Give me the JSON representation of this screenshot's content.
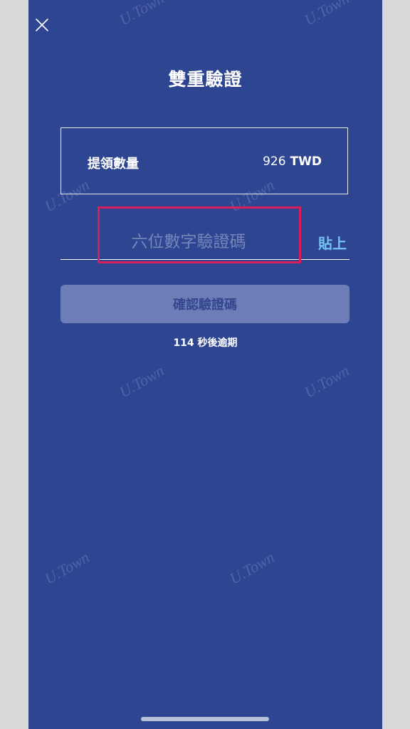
{
  "header": {
    "title": "雙重驗證",
    "close_icon": "close-icon"
  },
  "withdrawal": {
    "label": "提領數量",
    "amount": "926",
    "currency": "TWD"
  },
  "verification": {
    "placeholder": "六位數字驗證碼",
    "value": "",
    "paste_label": "貼上"
  },
  "actions": {
    "confirm_label": "確認驗證碼"
  },
  "timer": {
    "text": "114 秒後逾期"
  },
  "watermark": {
    "text": "U.Town"
  },
  "colors": {
    "background": "#2e4592",
    "paste_link": "#76c3f3",
    "highlight": "#d81e5b",
    "button_disabled": "#6d7db7"
  }
}
